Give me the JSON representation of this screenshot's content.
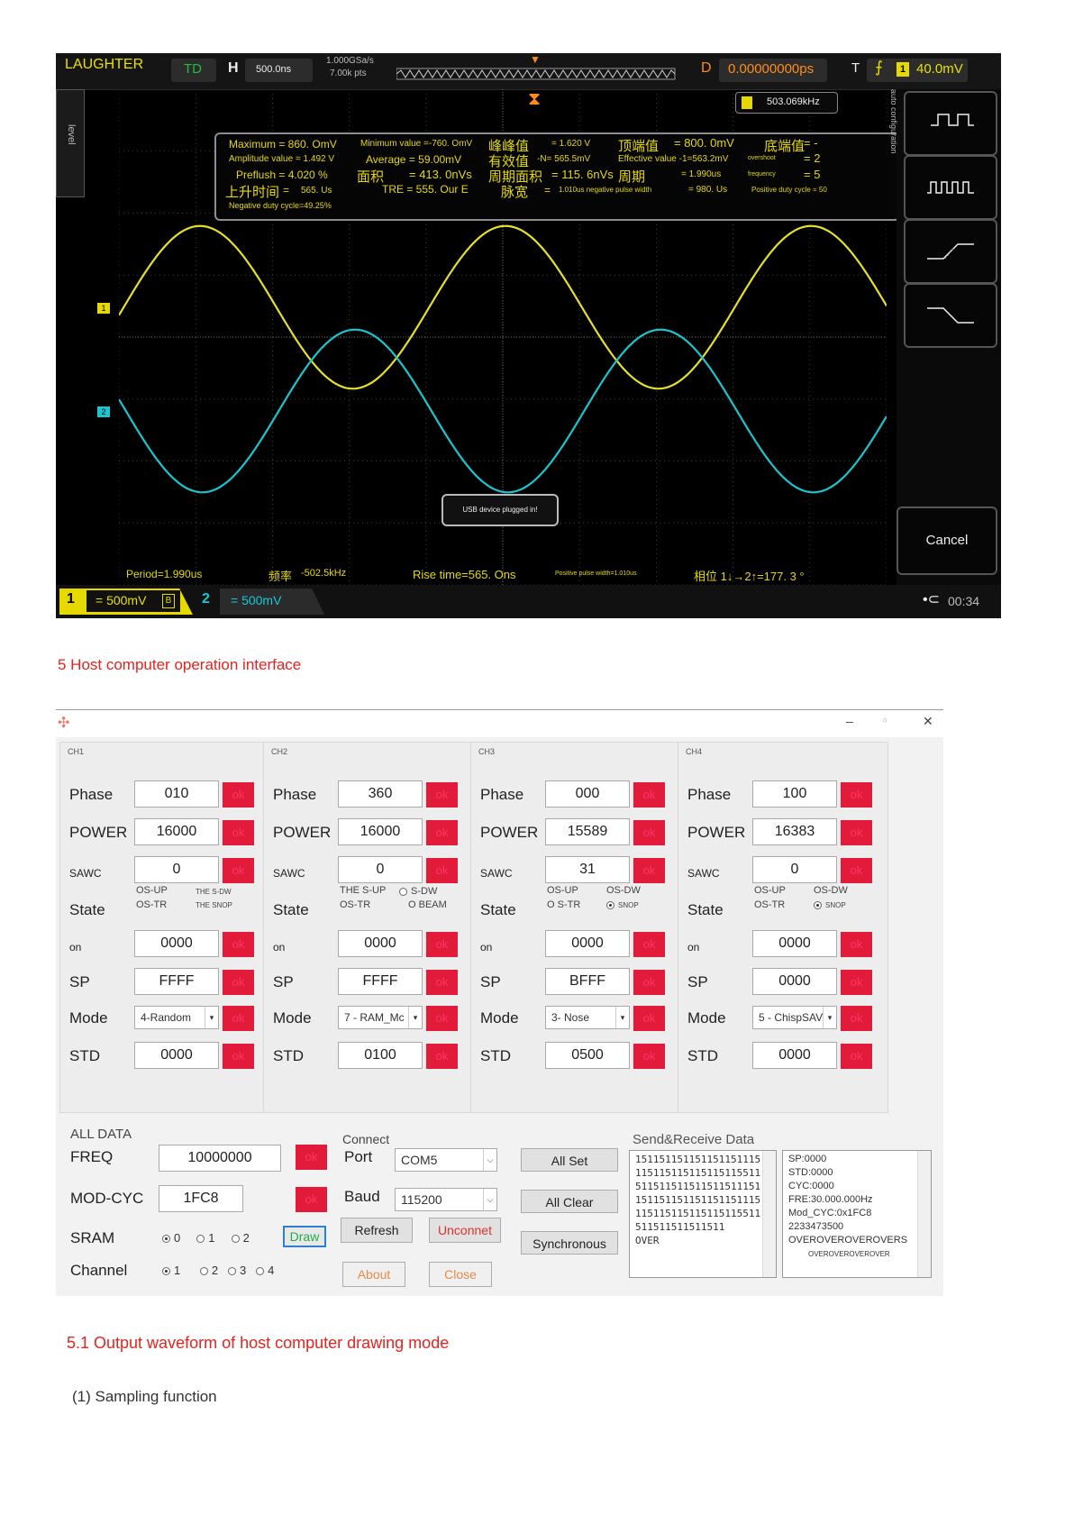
{
  "scope": {
    "brand": "LAUGHTER",
    "td": "TD",
    "h": "H",
    "timebase": "500.0ns",
    "samplerate": "1.000GSa/s",
    "points": "7.00k pts",
    "d": "D",
    "delay": "0.00000000ps",
    "t": "T",
    "trig_level": "40.0mV",
    "level_tab": "level",
    "auto_config": "auto configuration",
    "freq_counter": "503.069kHz",
    "measurements": {
      "max": "Maximum = 860. OmV",
      "min": "Minimum value =-760. OmV",
      "pk_label": "峰峰值",
      "pk_val": "= 1.620 V",
      "top_label": "顶端值",
      "top_val": "= 800. 0mV",
      "base_label": "底端值",
      "base_val": "= -",
      "amplitude": "Amplitude value = 1.492 V",
      "average": "Average = 59.00mV",
      "rms_label": "有效值",
      "rms_val": "-N= 565.5mV",
      "effective": "Effective value -1=563.2mV",
      "overshoot": "overshoot",
      "overshoot_val": "= 2",
      "preflush": "Preflush = 4.020 %",
      "area_label": "面积",
      "area_val": "= 413. 0nVs",
      "period_area_label": "周期面积",
      "period_area_val": "= 115. 6nVs",
      "period_label": "周期",
      "period_val": "= 1.990us",
      "frequency": "frequency",
      "frequency_val": "= 5",
      "rise_label": "上升时间",
      "rise_eq": "=",
      "rise_val": "565. Us",
      "tre": "TRE = 555. Our E",
      "pulse_label": "脉宽",
      "pulse_eq": "=",
      "neg_width": "1.010us negative pulse width",
      "neg_width_val": "= 980. Us",
      "pos_duty": "Positive duty cycle = 50",
      "neg_duty": "Negative duty cycle=49.25%"
    },
    "bottom_stats": {
      "period": "Period=1.990us",
      "freq_label": "频率",
      "freq_val": "-502.5kHz",
      "rise": "Rise time=565. Ons",
      "pos_pulse": "Positive pulse width=1.010us",
      "phase": "相位 1↓→2↑=177. 3 °"
    },
    "usb_popup": "USB device plugged in!",
    "cancel": "Cancel",
    "ch1_num": "1",
    "ch1_scale": "= 500mV",
    "ch1_b": "B",
    "ch2_num": "2",
    "ch2_scale": "= 500mV",
    "clock": "00:34",
    "marker1": "1",
    "marker2": "2",
    "colors": {
      "ch1": "#e6e02a",
      "ch2": "#19c5cf",
      "accent": "#ff8c1a"
    },
    "waves": {
      "ch1": {
        "amplitude_v": 0.746,
        "offset_v": 0.05,
        "period_us": 1.99
      },
      "ch2": {
        "amplitude_v": 0.746,
        "phase_deg": 177.3,
        "period_us": 1.99
      }
    }
  },
  "captions": {
    "c1": "5 Host computer operation interface",
    "c2": "5.1 Output waveform of host computer drawing mode",
    "c3": "(1) Sampling function"
  },
  "host": {
    "win_min": "–",
    "win_max": "▫",
    "win_close": "✕",
    "ok": "ok",
    "channels": [
      {
        "title": "CH1",
        "phase": "010",
        "power": "16000",
        "sawc": "0",
        "st_a": "OS-UP",
        "st_b": "OS-TR",
        "st_c": "THE S-DW",
        "st_d": "THE SNOP",
        "on": "0000",
        "sp": "FFFF",
        "mode": "4-Random",
        "std": "0000"
      },
      {
        "title": "CH2",
        "phase": "360",
        "power": "16000",
        "sawc": "0",
        "st_a": "THE S-UP",
        "st_b": "OS-TR",
        "st_c": "S-DW",
        "st_d": "O BEAM",
        "on": "0000",
        "sp": "FFFF",
        "mode": "7 - RAM_Mc",
        "std": "0100"
      },
      {
        "title": "CH3",
        "phase": "000",
        "power": "15589",
        "sawc": "31",
        "st_a": "OS-UP",
        "st_b": "O S-TR",
        "st_c": "OS-DW",
        "st_d": "SNOP",
        "on": "0000",
        "sp": "BFFF",
        "mode": "3- Nose",
        "std": "0500"
      },
      {
        "title": "CH4",
        "phase": "100",
        "power": "16383",
        "sawc": "0",
        "st_a": "OS-UP",
        "st_b": "OS-TR",
        "st_c": "OS-DW",
        "st_d": "SNOP",
        "on": "0000",
        "sp": "0000",
        "mode": "5 - ChispSAV",
        "std": "0000"
      }
    ],
    "labels": {
      "phase": "Phase",
      "power": "POWER",
      "sawc": "SAWC",
      "state": "State",
      "on": "on",
      "sp": "SP",
      "mode": "Mode",
      "std": "STD"
    },
    "all_data": {
      "title": "ALL DATA",
      "freq_label": "FREQ",
      "freq": "10000000",
      "modcyc_label": "MOD-CYC",
      "modcyc": "1FC8",
      "sram_label": "SRAM",
      "sram_opts": [
        "0",
        "1",
        "2"
      ],
      "draw": "Draw",
      "channel_label": "Channel",
      "channel_opts": [
        "1",
        "2",
        "3",
        "4"
      ]
    },
    "connect": {
      "title": "Connect",
      "port_label": "Port",
      "port": "COM5",
      "baud_label": "Baud",
      "baud": "115200",
      "refresh": "Refresh",
      "unconnect": "Unconnet",
      "about": "About",
      "close": "Close"
    },
    "actions": {
      "all_set": "All Set",
      "all_clear": "All Clear",
      "sync": "Synchronous"
    },
    "send_recv": {
      "title": "Send&Receive Data",
      "send": [
        "151151151151151151115",
        "115115115115115115511",
        "511511511511511511151",
        "151151151151151151115",
        "115115115115115115511",
        "511511511511511",
        "OVER"
      ],
      "recv": [
        "SP:0000",
        "STD:0000",
        "CYC:0000",
        "FRE:30.000.000Hz",
        "Mod_CYC:0x1FC8",
        "2233473500",
        "OVEROVEROVEROVERS",
        "OVEROVEROVEROVER"
      ]
    }
  }
}
